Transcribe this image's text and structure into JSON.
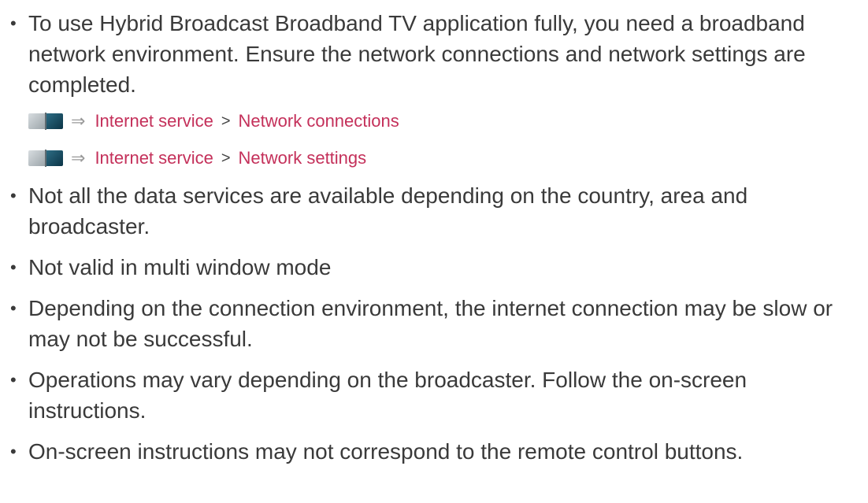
{
  "bullet_glyph": "•",
  "items": [
    {
      "text": "To use Hybrid Broadcast Broadband TV application fully, you need a broadband network environment. Ensure the network connections and network settings are completed."
    },
    {
      "text": "Not all the data services are available depending on the country, area and broadcaster."
    },
    {
      "text": "Not valid in multi window mode"
    },
    {
      "text": "Depending on the connection environment, the internet connection may be slow or may not be successful."
    },
    {
      "text": "Operations may vary depending on the broadcaster. Follow the on-screen instructions."
    },
    {
      "text": "On-screen instructions may not correspond to the remote control buttons."
    }
  ],
  "references": [
    {
      "arrow": "⇒",
      "section": "Internet service",
      "separator": ">",
      "page": "Network connections"
    },
    {
      "arrow": "⇒",
      "section": "Internet service",
      "separator": ">",
      "page": "Network settings"
    }
  ],
  "icons": {
    "manual": "book-icon"
  },
  "colors": {
    "text": "#3a3a3a",
    "link": "#c4305a"
  }
}
